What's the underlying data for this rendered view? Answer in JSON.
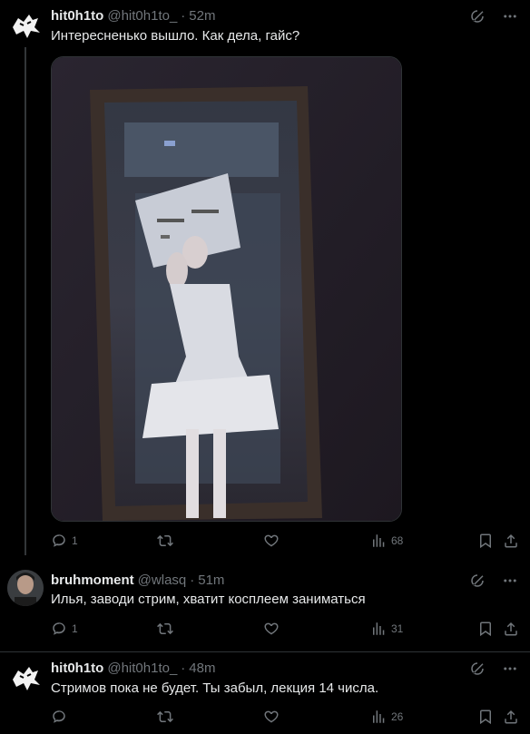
{
  "posts": [
    {
      "name": "hit0h1to",
      "handle": "@hit0h1to_",
      "time": "52m",
      "text": "Интересненько вышло. Как дела, гайс?",
      "stats": {
        "replies": "1",
        "retweets": "",
        "likes": "",
        "views": "68"
      }
    },
    {
      "name": "bruhmoment",
      "handle": "@wlasq",
      "time": "51m",
      "text": "Илья, заводи стрим, хватит косплеем заниматься",
      "stats": {
        "replies": "1",
        "retweets": "",
        "likes": "",
        "views": "31"
      }
    },
    {
      "name": "hit0h1to",
      "handle": "@hit0h1to_",
      "time": "48m",
      "text": "Стримов пока не будет. Ты забыл, лекция 14 числа.",
      "stats": {
        "replies": "",
        "retweets": "",
        "likes": "",
        "views": "26"
      }
    }
  ],
  "separator": "·",
  "icons": {
    "grok": "grok-slash-icon",
    "more": "more-dots-icon",
    "reply": "reply-bubble-icon",
    "retweet": "retweet-icon",
    "like": "heart-icon",
    "views": "views-bars-icon",
    "bookmark": "bookmark-icon",
    "share": "share-icon"
  },
  "colors": {
    "background": "#000000",
    "text": "#e7e9ea",
    "muted": "#71767b",
    "border": "#2f3336"
  }
}
